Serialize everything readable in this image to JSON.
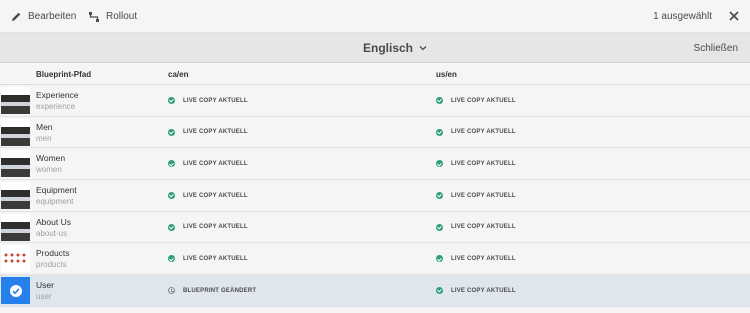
{
  "toolbar": {
    "edit_label": "Bearbeiten",
    "rollout_label": "Rollout",
    "selected_count": "1 ausgewählt"
  },
  "language_bar": {
    "language": "Englisch",
    "close_label": "Schließen"
  },
  "table": {
    "headers": {
      "path": "Blueprint-Pfad",
      "ca_en": "ca/en",
      "us_en": "us/en"
    },
    "rows": [
      {
        "title": "Experience",
        "name": "experience",
        "ca_status": "LIVE COPY AKTUELL",
        "us_status": "LIVE COPY AKTUELL"
      },
      {
        "title": "Men",
        "name": "men",
        "ca_status": "LIVE COPY AKTUELL",
        "us_status": "LIVE COPY AKTUELL"
      },
      {
        "title": "Women",
        "name": "women",
        "ca_status": "LIVE COPY AKTUELL",
        "us_status": "LIVE COPY AKTUELL"
      },
      {
        "title": "Equipment",
        "name": "equipment",
        "ca_status": "LIVE COPY AKTUELL",
        "us_status": "LIVE COPY AKTUELL"
      },
      {
        "title": "About Us",
        "name": "about-us",
        "ca_status": "LIVE COPY AKTUELL",
        "us_status": "LIVE COPY AKTUELL"
      },
      {
        "title": "Products",
        "name": "products",
        "ca_status": "LIVE COPY AKTUELL",
        "us_status": "LIVE COPY AKTUELL"
      },
      {
        "title": "User",
        "name": "user",
        "ca_status": "BLUEPRINT GEÄNDERT",
        "us_status": "LIVE COPY AKTUELL"
      }
    ]
  },
  "colors": {
    "ok": "#2d9d78",
    "selection": "#2680eb",
    "selected_row": "#e0e6ee"
  },
  "icons": [
    "pencil-icon",
    "rollout-icon",
    "close-icon",
    "chevron-down-icon",
    "checkmark-circle-icon",
    "clock-icon"
  ]
}
